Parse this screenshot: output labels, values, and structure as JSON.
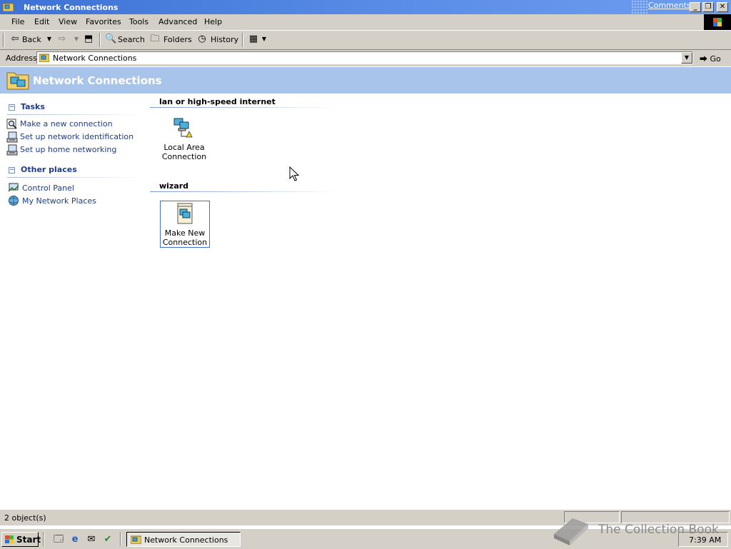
{
  "window": {
    "title": "Network Connections",
    "comments_link": "Comments?",
    "controls": [
      "minimize",
      "restore",
      "close"
    ]
  },
  "menubar": {
    "items": [
      "File",
      "Edit",
      "View",
      "Favorites",
      "Tools",
      "Advanced",
      "Help"
    ]
  },
  "toolbar": {
    "back_label": "Back",
    "search_label": "Search",
    "folders_label": "Folders",
    "history_label": "History"
  },
  "address": {
    "label": "Address",
    "value": "Network Connections",
    "go_label": "Go"
  },
  "banner": {
    "title": "Network Connections"
  },
  "left_pane": {
    "tasks": {
      "title": "Tasks",
      "toggle": "−",
      "items": [
        {
          "label": "Make a new connection",
          "icon": "magnifier-icon"
        },
        {
          "label": "Set up network identification",
          "icon": "network-setup-icon"
        },
        {
          "label": "Set up home networking",
          "icon": "home-network-icon"
        }
      ]
    },
    "other_places": {
      "title": "Other places",
      "toggle": "−",
      "items": [
        {
          "label": "Control Panel",
          "icon": "control-panel-icon"
        },
        {
          "label": "My Network Places",
          "icon": "network-places-icon"
        }
      ]
    }
  },
  "content": {
    "groups": [
      {
        "title": "lan or high-speed internet",
        "items": [
          {
            "line1": "Local Area",
            "line2": "Connection",
            "icon": "lan-connection-icon"
          }
        ]
      },
      {
        "title": "wizard",
        "items": [
          {
            "line1": "Make New",
            "line2": "Connection",
            "icon": "new-connection-wizard-icon"
          }
        ]
      }
    ]
  },
  "statusbar": {
    "text": "2 object(s)"
  },
  "taskbar": {
    "start_label": "Start",
    "task_label": "Network Connections",
    "clock": "7:39 AM"
  },
  "watermark": {
    "text": "The Collection Book"
  },
  "colors": {
    "titlebar": "#3c72d6",
    "banner": "#a9c4ea",
    "link": "#1e3c8c",
    "chrome": "#d4d0c8"
  }
}
